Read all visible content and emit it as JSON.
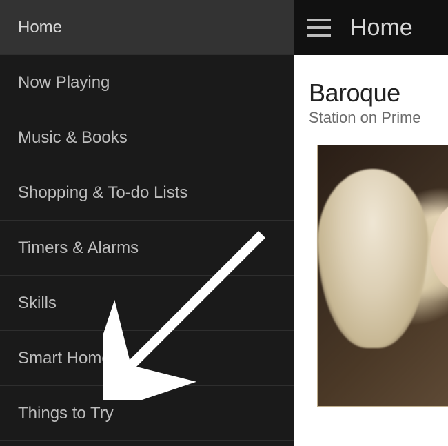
{
  "sidebar": {
    "items": [
      {
        "label": "Home",
        "active": true
      },
      {
        "label": "Now Playing"
      },
      {
        "label": "Music & Books"
      },
      {
        "label": "Shopping & To-do Lists"
      },
      {
        "label": "Timers & Alarms"
      },
      {
        "label": "Skills"
      },
      {
        "label": "Smart Home"
      },
      {
        "label": "Things to Try"
      }
    ]
  },
  "header": {
    "title": "Home"
  },
  "card": {
    "title": "Baroque",
    "subtitle": "Station on Prime"
  }
}
